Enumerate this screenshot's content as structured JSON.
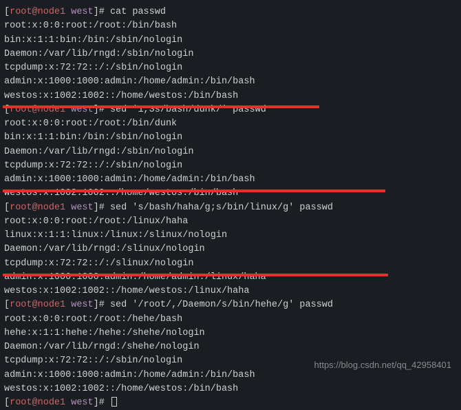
{
  "prompt": {
    "user_host": "root@node1",
    "cwd": "west",
    "open": "[",
    "close": "]#"
  },
  "blocks": [
    {
      "cmd": "cat passwd",
      "out": [
        "root:x:0:0:root:/root:/bin/bash",
        "bin:x:1:1:bin:/bin:/sbin/nologin",
        "Daemon:/var/lib/rngd:/sbin/nologin",
        "tcpdump:x:72:72::/:/sbin/nologin",
        "admin:x:1000:1000:admin:/home/admin:/bin/bash",
        "westos:x:1002:1002::/home/westos:/bin/bash"
      ]
    },
    {
      "cmd": "sed '1,3s/bash/dunk/' passwd",
      "out": [
        "root:x:0:0:root:/root:/bin/dunk",
        "bin:x:1:1:bin:/bin:/sbin/nologin",
        "Daemon:/var/lib/rngd:/sbin/nologin",
        "tcpdump:x:72:72::/:/sbin/nologin",
        "admin:x:1000:1000:admin:/home/admin:/bin/bash",
        "westos:x:1002:1002::/home/westos:/bin/bash"
      ]
    },
    {
      "cmd": "sed 's/bash/haha/g;s/bin/linux/g' passwd",
      "out": [
        "root:x:0:0:root:/root:/linux/haha",
        "linux:x:1:1:linux:/linux:/slinux/nologin",
        "Daemon:/var/lib/rngd:/slinux/nologin",
        "tcpdump:x:72:72::/:/slinux/nologin",
        "admin:x:1000:1000:admin:/home/admin:/linux/haha",
        "westos:x:1002:1002::/home/westos:/linux/haha"
      ]
    },
    {
      "cmd": "sed '/root/,/Daemon/s/bin/hehe/g' passwd",
      "out": [
        "root:x:0:0:root:/root:/hehe/bash",
        "hehe:x:1:1:hehe:/hehe:/shehe/nologin",
        "Daemon:/var/lib/rngd:/shehe/nologin",
        "tcpdump:x:72:72::/:/sbin/nologin",
        "admin:x:1000:1000:admin:/home/admin:/bin/bash",
        "westos:x:1002:1002::/home/westos:/bin/bash"
      ]
    }
  ],
  "finalPrompt": true,
  "watermark": "https://blog.csdn.net/qq_42958401"
}
